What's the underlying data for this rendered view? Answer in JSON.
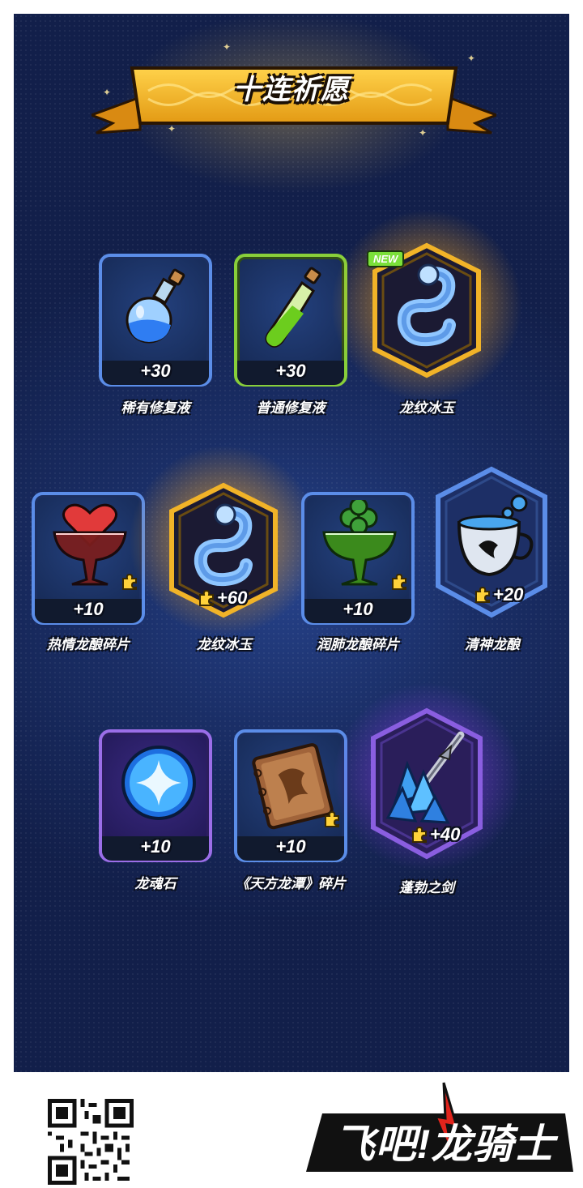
{
  "header": {
    "title": "十连祈愿"
  },
  "rows": [
    [
      {
        "name": "稀有修复液",
        "count": "+30",
        "icon": "blue-potion-icon"
      },
      {
        "name": "普通修复液",
        "count": "+30",
        "icon": "green-potion-icon"
      },
      {
        "name": "龙纹冰玉",
        "count": "",
        "icon": "ice-dragon-icon",
        "badge": "NEW"
      }
    ],
    [
      {
        "name": "热情龙酿碎片",
        "count": "+10",
        "icon": "heart-cocktail-icon"
      },
      {
        "name": "龙纹冰玉",
        "count": "+60",
        "icon": "ice-dragon-icon"
      },
      {
        "name": "润肺龙酿碎片",
        "count": "+10",
        "icon": "clover-cocktail-icon"
      },
      {
        "name": "清神龙酿",
        "count": "+20",
        "icon": "dragon-teacup-icon"
      }
    ],
    [
      {
        "name": "龙魂石",
        "count": "+10",
        "icon": "soul-stone-icon"
      },
      {
        "name": "《天方龙潭》碎片",
        "count": "+10",
        "icon": "old-book-icon"
      },
      {
        "name": "蓬勃之剑",
        "count": "+40",
        "icon": "crystal-sword-icon"
      }
    ]
  ],
  "footer": {
    "logo_text": "飞吧!龙骑士"
  },
  "colors": {
    "rarity_blue": "#5b8de8",
    "rarity_green": "#88cf3a",
    "rarity_purple": "#9b6ee8",
    "rarity_gold": "#f1b328"
  }
}
